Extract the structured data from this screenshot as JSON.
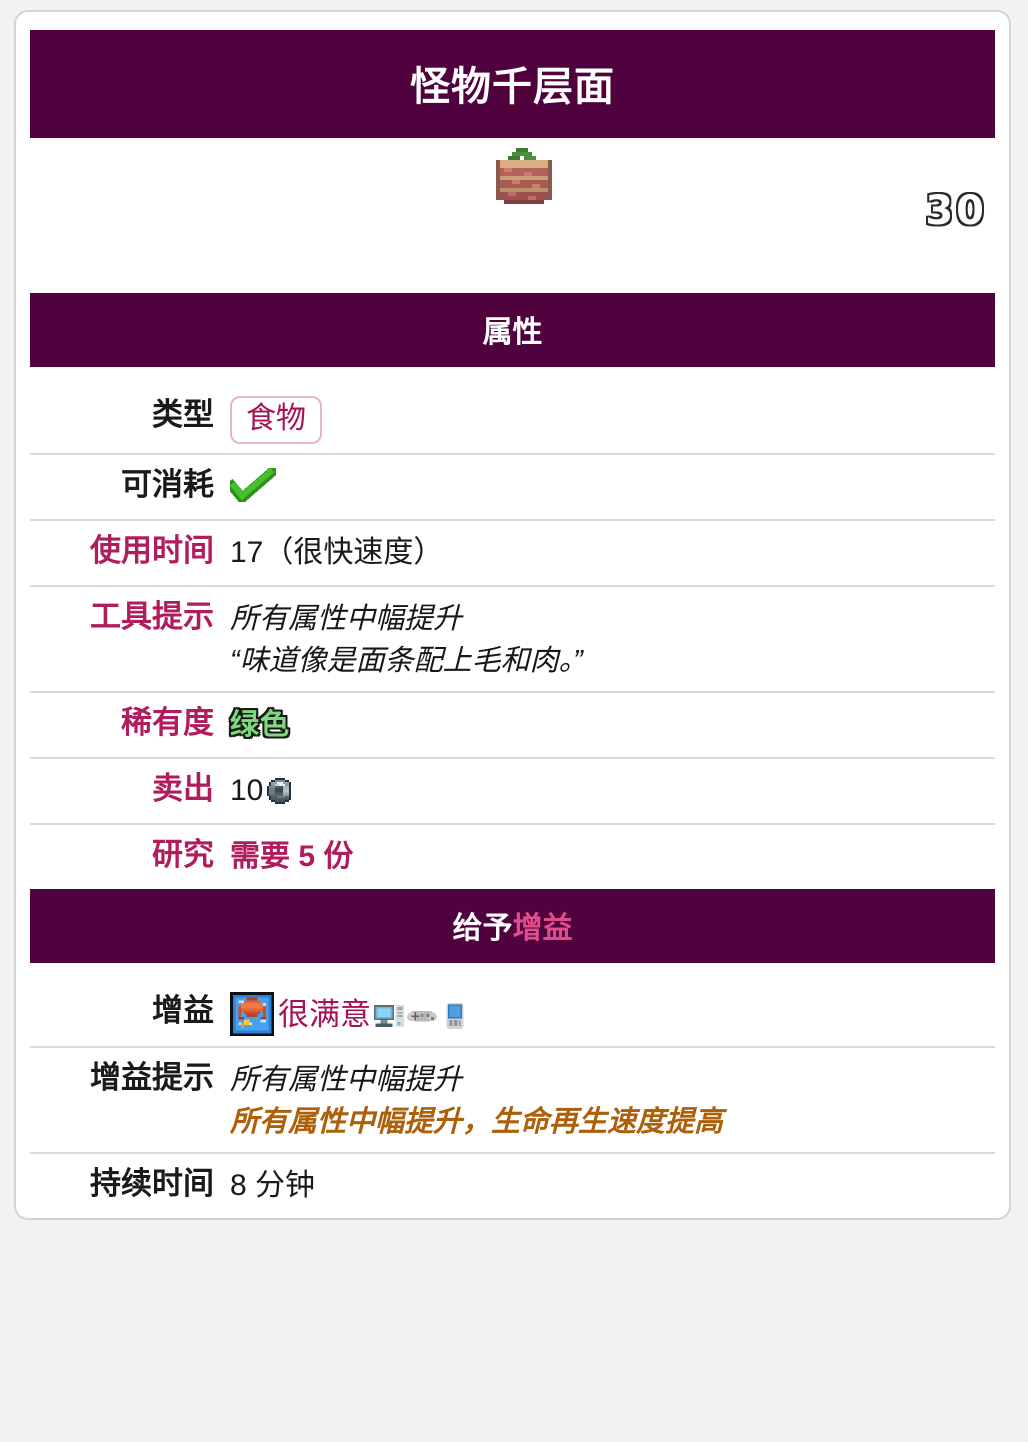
{
  "theme": {
    "header_bg": "#50023f",
    "link_pink": "#b01c5c",
    "accent_orange": "#ad6009",
    "rarity_green": "#7ddb7d",
    "page_bg": "#f3f1f3",
    "card_bg": "#ffffff",
    "border_gray": "#d7d2d7"
  },
  "infobox": {
    "title": "怪物千层面",
    "image": {
      "sprite_name": "monster-lasagna-sprite",
      "stack_count": "30"
    },
    "sections": [
      {
        "id": "statistics",
        "header": {
          "text": "属性",
          "link_part": ""
        },
        "rows": [
          {
            "label": "类型",
            "label_is_link": false,
            "value_kind": "badge",
            "value": "食物"
          },
          {
            "label": "可消耗",
            "label_is_link": false,
            "value_kind": "check",
            "value": ""
          },
          {
            "label": "使用时间",
            "label_is_link": true,
            "value_kind": "text",
            "value": "17（很快速度）"
          },
          {
            "label": "工具提示",
            "label_is_link": true,
            "value_kind": "tooltip",
            "line1": "所有属性中幅提升",
            "line2": "“味道像是面条配上毛和肉。”"
          },
          {
            "label": "稀有度",
            "label_is_link": true,
            "value_kind": "rarity",
            "value": "绿色"
          },
          {
            "label": "卖出",
            "label_is_link": true,
            "value_kind": "coin",
            "value": "10",
            "coin_name": "silver-coin-icon"
          },
          {
            "label": "研究",
            "label_is_link": true,
            "value_kind": "research",
            "value": "需要 5 份"
          }
        ]
      },
      {
        "id": "grants-buff",
        "header": {
          "text": "给予",
          "link_part": "增益"
        },
        "rows": [
          {
            "label": "增益",
            "label_is_link": false,
            "value_kind": "buff",
            "value": "很满意",
            "buff_icon_name": "well-fed-buff-icon",
            "platforms": [
              "desktop-icon",
              "console-icon",
              "mobile-icon"
            ]
          },
          {
            "label": "增益提示",
            "label_is_link": false,
            "value_kind": "bufftip",
            "line1": "所有属性中幅提升",
            "line2": "所有属性中幅提升，生命再生速度提高"
          },
          {
            "label": "持续时间",
            "label_is_link": false,
            "value_kind": "text",
            "value": "8 分钟"
          }
        ]
      }
    ]
  }
}
